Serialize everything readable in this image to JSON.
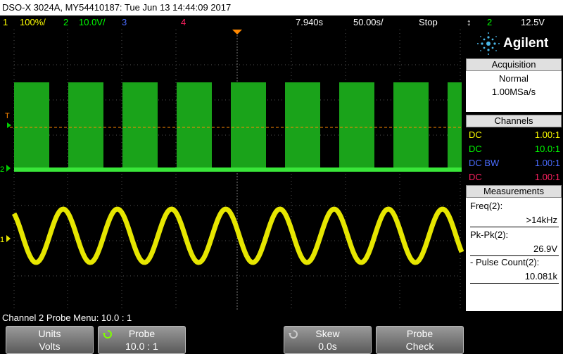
{
  "titlebar": {
    "text": "DSO-X 3024A, MY54410187: Tue Jun 13 14:44:09 2017"
  },
  "statusbar": {
    "ch1_num": "1",
    "ch1_scale": "100%/",
    "ch2_num": "2",
    "ch2_scale": "10.0V/",
    "ch3_num": "3",
    "ch4_num": "4",
    "time_pos": "7.940s",
    "time_scale": "50.00s/",
    "run_state": "Stop",
    "trig_arrow": "↕",
    "trig_source": "2",
    "trig_level": "12.5V"
  },
  "screen": {
    "trigger_marker": "T",
    "ch2_marker": "2",
    "ch1_marker": "1"
  },
  "logo": {
    "text": "Agilent"
  },
  "acquisition": {
    "title": "Acquisition",
    "mode": "Normal",
    "rate": "1.00MSa/s"
  },
  "channels": {
    "title": "Channels",
    "rows": [
      {
        "coupling": "DC",
        "ratio": "1.00:1",
        "color": "#ffff00"
      },
      {
        "coupling": "DC",
        "ratio": "10.0:1",
        "color": "#00ff00"
      },
      {
        "coupling": "DC BW",
        "ratio": "1.00:1",
        "color": "#4a6cff"
      },
      {
        "coupling": "DC",
        "ratio": "1.00:1",
        "color": "#ff2060"
      }
    ]
  },
  "measurements": {
    "title": "Measurements",
    "freq_label": "Freq(2):",
    "freq_value": ">14kHz",
    "pkpk_label": "Pk-Pk(2):",
    "pkpk_value": "26.9V",
    "pulse_label": "- Pulse Count(2):",
    "pulse_value": "10.081k"
  },
  "bottom": {
    "probe_menu": "Channel 2 Probe Menu: 10.0 : 1",
    "softkeys": [
      {
        "top": "Units",
        "bottom": "Volts"
      },
      {
        "top": "Probe",
        "bottom": "10.0 : 1"
      },
      {
        "top": "Skew",
        "bottom": "0.0s"
      },
      {
        "top": "Probe",
        "bottom": "Check"
      }
    ]
  },
  "colors": {
    "ch1": "#ffff00",
    "ch2": "#00cc00",
    "ch3": "#4a6cff",
    "ch4": "#ff2060",
    "trigger": "#ff8800"
  }
}
